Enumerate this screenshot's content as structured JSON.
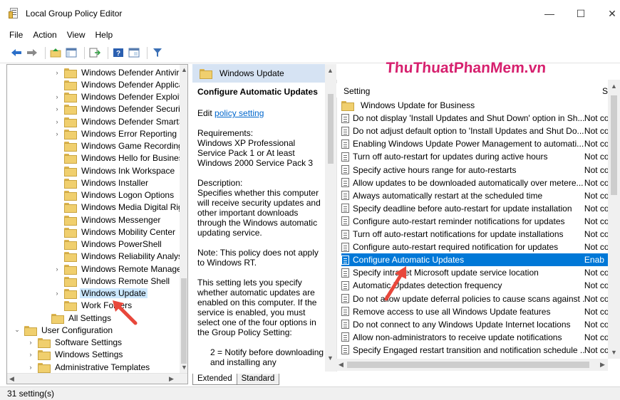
{
  "window": {
    "title": "Local Group Policy Editor",
    "minimize": "—",
    "maximize": "☐",
    "close": "✕"
  },
  "menu": [
    "File",
    "Action",
    "View",
    "Help"
  ],
  "watermark": "ThuThuatPhanMem.vn",
  "tree": {
    "items": [
      {
        "label": "Windows Defender Antiviru:",
        "expander": "›",
        "depth": 1
      },
      {
        "label": "Windows Defender Applicat",
        "expander": "",
        "depth": 1
      },
      {
        "label": "Windows Defender Exploit G",
        "expander": "›",
        "depth": 1
      },
      {
        "label": "Windows Defender Security",
        "expander": "›",
        "depth": 1
      },
      {
        "label": "Windows Defender SmartSc",
        "expander": "›",
        "depth": 1
      },
      {
        "label": "Windows Error Reporting",
        "expander": "›",
        "depth": 1
      },
      {
        "label": "Windows Game Recording a",
        "expander": "",
        "depth": 1
      },
      {
        "label": "Windows Hello for Business",
        "expander": "",
        "depth": 1
      },
      {
        "label": "Windows Ink Workspace",
        "expander": "",
        "depth": 1
      },
      {
        "label": "Windows Installer",
        "expander": "",
        "depth": 1
      },
      {
        "label": "Windows Logon Options",
        "expander": "",
        "depth": 1
      },
      {
        "label": "Windows Media Digital Righ",
        "expander": "",
        "depth": 1
      },
      {
        "label": "Windows Messenger",
        "expander": "",
        "depth": 1
      },
      {
        "label": "Windows Mobility Center",
        "expander": "",
        "depth": 1
      },
      {
        "label": "Windows PowerShell",
        "expander": "",
        "depth": 1
      },
      {
        "label": "Windows Reliability Analysis",
        "expander": "",
        "depth": 1
      },
      {
        "label": "Windows Remote Managem",
        "expander": "›",
        "depth": 1
      },
      {
        "label": "Windows Remote Shell",
        "expander": "",
        "depth": 1
      },
      {
        "label": "Windows Update",
        "expander": "›",
        "depth": 1,
        "selected": true
      },
      {
        "label": "Work Folders",
        "expander": "",
        "depth": 1
      },
      {
        "label": "All Settings",
        "expander": "",
        "depth": 0.5
      },
      {
        "label": "User Configuration",
        "expander": "⌄",
        "depth": 0
      },
      {
        "label": "Software Settings",
        "expander": "›",
        "depth": 0.6
      },
      {
        "label": "Windows Settings",
        "expander": "›",
        "depth": 0.6
      },
      {
        "label": "Administrative Templates",
        "expander": "›",
        "depth": 0.6
      }
    ]
  },
  "description": {
    "header": "Windows Update",
    "title": "Configure Automatic Updates",
    "edit_prefix": "Edit ",
    "edit_link": "policy setting",
    "requirements": "Requirements:\nWindows XP Professional Service Pack 1 or At least Windows 2000 Service Pack 3",
    "description": "Description:\nSpecifies whether this computer will receive security updates and other important downloads through the Windows automatic updating service.",
    "note": "Note: This policy does not apply to Windows RT.",
    "setting_lets": "This setting lets you specify whether automatic updates are enabled on this computer. If the service is enabled, you must select one of the four options in the Group Policy Setting:",
    "option2": "2 = Notify before downloading and installing any"
  },
  "list": {
    "col_setting": "Setting",
    "col_state": "Sta",
    "rows": [
      {
        "name": "Windows Update for Business",
        "state": "",
        "kind": "folder"
      },
      {
        "name": "Do not display 'Install Updates and Shut Down' option in Sh...",
        "state": "Not con",
        "kind": "policy"
      },
      {
        "name": "Do not adjust default option to 'Install Updates and Shut Do...",
        "state": "Not con",
        "kind": "policy"
      },
      {
        "name": "Enabling Windows Update Power Management to automati...",
        "state": "Not con",
        "kind": "policy"
      },
      {
        "name": "Turn off auto-restart for updates during active hours",
        "state": "Not con",
        "kind": "policy"
      },
      {
        "name": "Specify active hours range for auto-restarts",
        "state": "Not con",
        "kind": "policy"
      },
      {
        "name": "Allow updates to be downloaded automatically over metere...",
        "state": "Not con",
        "kind": "policy"
      },
      {
        "name": "Always automatically restart at the scheduled time",
        "state": "Not con",
        "kind": "policy"
      },
      {
        "name": "Specify deadline before auto-restart for update installation",
        "state": "Not con",
        "kind": "policy"
      },
      {
        "name": "Configure auto-restart reminder notifications for updates",
        "state": "Not con",
        "kind": "policy"
      },
      {
        "name": "Turn off auto-restart notifications for update installations",
        "state": "Not con",
        "kind": "policy"
      },
      {
        "name": "Configure auto-restart required notification for updates",
        "state": "Not con",
        "kind": "policy"
      },
      {
        "name": "Configure Automatic Updates",
        "state": "Enab",
        "kind": "policy",
        "selected": true
      },
      {
        "name": "Specify intranet Microsoft update service location",
        "state": "Not con",
        "kind": "policy"
      },
      {
        "name": "Automatic Updates detection frequency",
        "state": "Not con",
        "kind": "policy"
      },
      {
        "name": "Do not allow update deferral policies to cause scans against ...",
        "state": "Not con",
        "kind": "policy"
      },
      {
        "name": "Remove access to use all Windows Update features",
        "state": "Not con",
        "kind": "policy"
      },
      {
        "name": "Do not connect to any Windows Update Internet locations",
        "state": "Not con",
        "kind": "policy"
      },
      {
        "name": "Allow non-administrators to receive update notifications",
        "state": "Not con",
        "kind": "policy"
      },
      {
        "name": "Specify Engaged restart transition and notification schedule ...",
        "state": "Not con",
        "kind": "policy"
      }
    ]
  },
  "tabs": [
    "Extended",
    "Standard"
  ],
  "status": "31 setting(s)",
  "colors": {
    "selection": "#0078d7",
    "tree_selection": "#cce8ff",
    "watermark": "#d6206e",
    "arrow": "#e8473b"
  }
}
